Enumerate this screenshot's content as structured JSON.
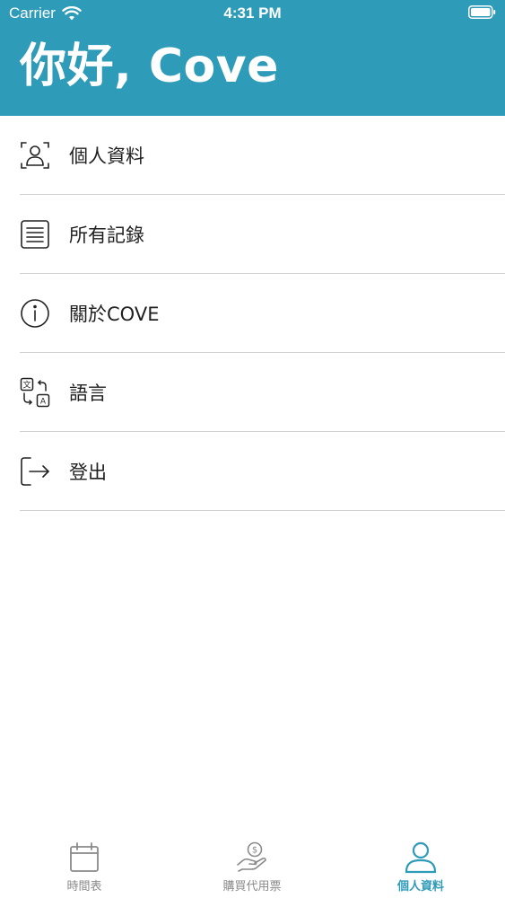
{
  "status_bar": {
    "carrier": "Carrier",
    "time": "4:31 PM"
  },
  "header": {
    "greeting": "你好, Cove",
    "background_color": "#2e9bb9"
  },
  "menu": {
    "items": [
      {
        "label": "個人資料",
        "icon": "profile-scan-icon"
      },
      {
        "label": "所有記錄",
        "icon": "document-list-icon"
      },
      {
        "label": "關於COVE",
        "icon": "info-icon"
      },
      {
        "label": "語言",
        "icon": "language-translate-icon"
      },
      {
        "label": "登出",
        "icon": "logout-icon"
      }
    ]
  },
  "tabbar": {
    "tabs": [
      {
        "label": "時間表",
        "icon": "calendar-icon",
        "active": false
      },
      {
        "label": "購買代用票",
        "icon": "coin-hand-icon",
        "active": false
      },
      {
        "label": "個人資料",
        "icon": "person-icon",
        "active": true
      }
    ],
    "active_color": "#2e9bb9",
    "inactive_color": "#8a8a8a"
  }
}
